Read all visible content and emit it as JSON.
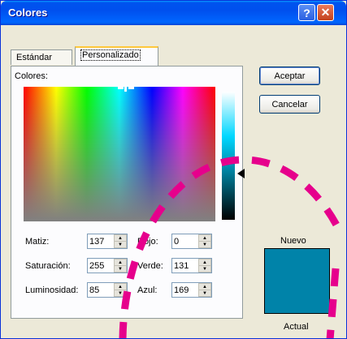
{
  "window": {
    "title": "Colores"
  },
  "titlebar_buttons": {
    "help": "?",
    "close": "✕"
  },
  "tabs": [
    {
      "label": "Estándar"
    },
    {
      "label": "Personalizado"
    }
  ],
  "palette_label": "Colores:",
  "fields": {
    "matiz": {
      "label": "Matiz:",
      "value": "137"
    },
    "saturacion": {
      "label": "Saturación:",
      "value": "255"
    },
    "luminosidad": {
      "label": "Luminosidad:",
      "value": "85"
    },
    "rojo": {
      "label": "Rojo:",
      "value": "0"
    },
    "verde": {
      "label": "Verde:",
      "value": "131"
    },
    "azul": {
      "label": "Azul:",
      "value": "169"
    }
  },
  "buttons": {
    "ok": "Aceptar",
    "cancel": "Cancelar"
  },
  "preview": {
    "new_label": "Nuevo",
    "current_label": "Actual",
    "color": "#0083a9"
  },
  "colors": {
    "accent": "#0053ee",
    "annotation": "#e6008c"
  }
}
